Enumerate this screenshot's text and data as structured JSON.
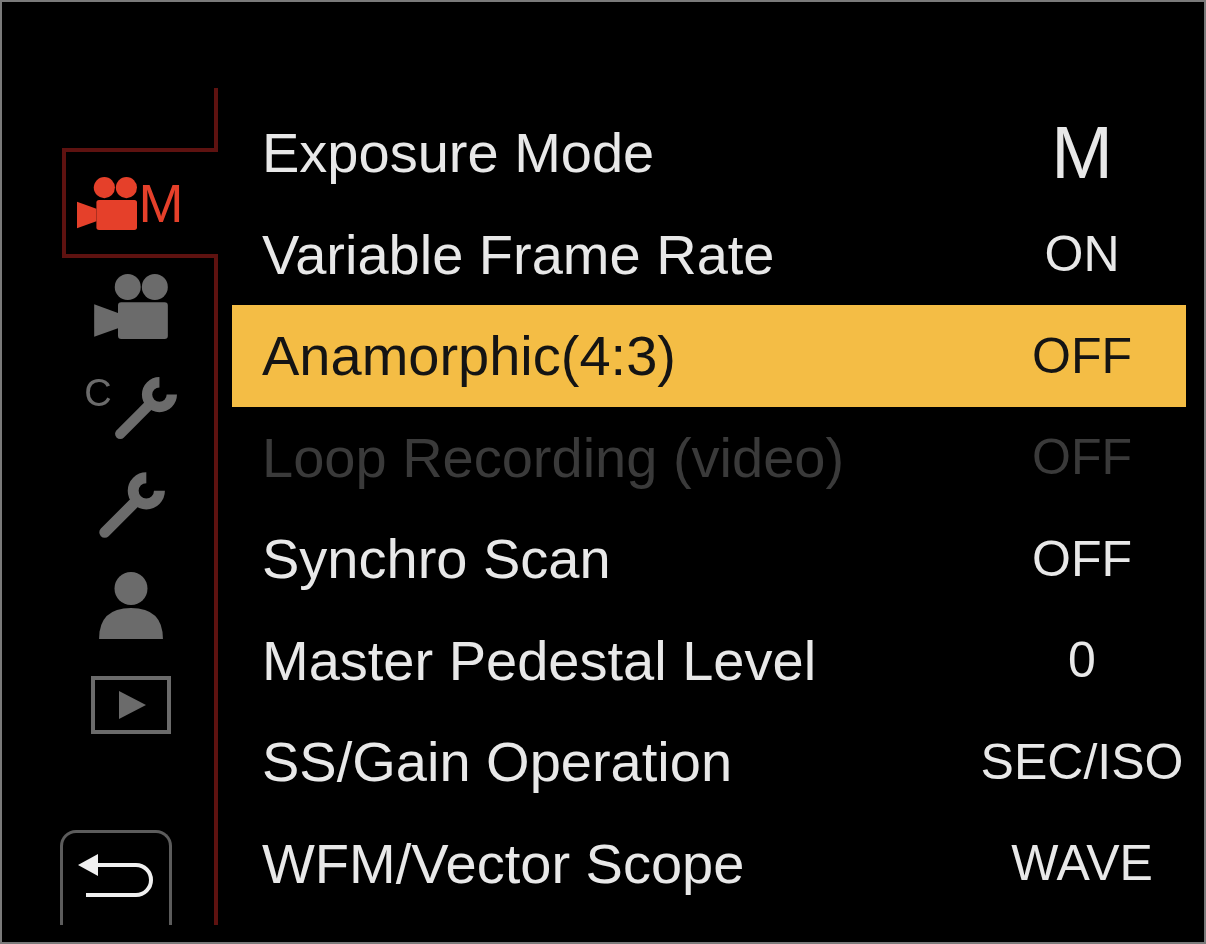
{
  "tabs": [
    {
      "kind": "creative",
      "label": "M",
      "selected": true
    },
    {
      "kind": "video",
      "selected": false
    },
    {
      "kind": "custom",
      "label": "C",
      "selected": false
    },
    {
      "kind": "setup",
      "selected": false
    },
    {
      "kind": "mymenu",
      "selected": false
    },
    {
      "kind": "playback",
      "selected": false
    }
  ],
  "back_button": {
    "kind": "return"
  },
  "rows": [
    {
      "label": "Exposure Mode",
      "value": "M",
      "kind": "symbol",
      "selected": false,
      "disabled": false
    },
    {
      "label": "Variable Frame Rate",
      "value": "ON",
      "kind": "text",
      "selected": false,
      "disabled": false
    },
    {
      "label": "Anamorphic(4:3)",
      "value": "OFF",
      "kind": "text",
      "selected": true,
      "disabled": false
    },
    {
      "label": "Loop Recording (video)",
      "value": "OFF",
      "kind": "text",
      "selected": false,
      "disabled": true
    },
    {
      "label": "Synchro Scan",
      "value": "OFF",
      "kind": "text",
      "selected": false,
      "disabled": false
    },
    {
      "label": "Master Pedestal Level",
      "value": "0",
      "kind": "text",
      "selected": false,
      "disabled": false
    },
    {
      "label": "SS/Gain Operation",
      "value": "SEC/ISO",
      "kind": "text",
      "selected": false,
      "disabled": false
    },
    {
      "label": "WFM/Vector Scope",
      "value": "WAVE",
      "kind": "text",
      "selected": false,
      "disabled": false
    }
  ]
}
